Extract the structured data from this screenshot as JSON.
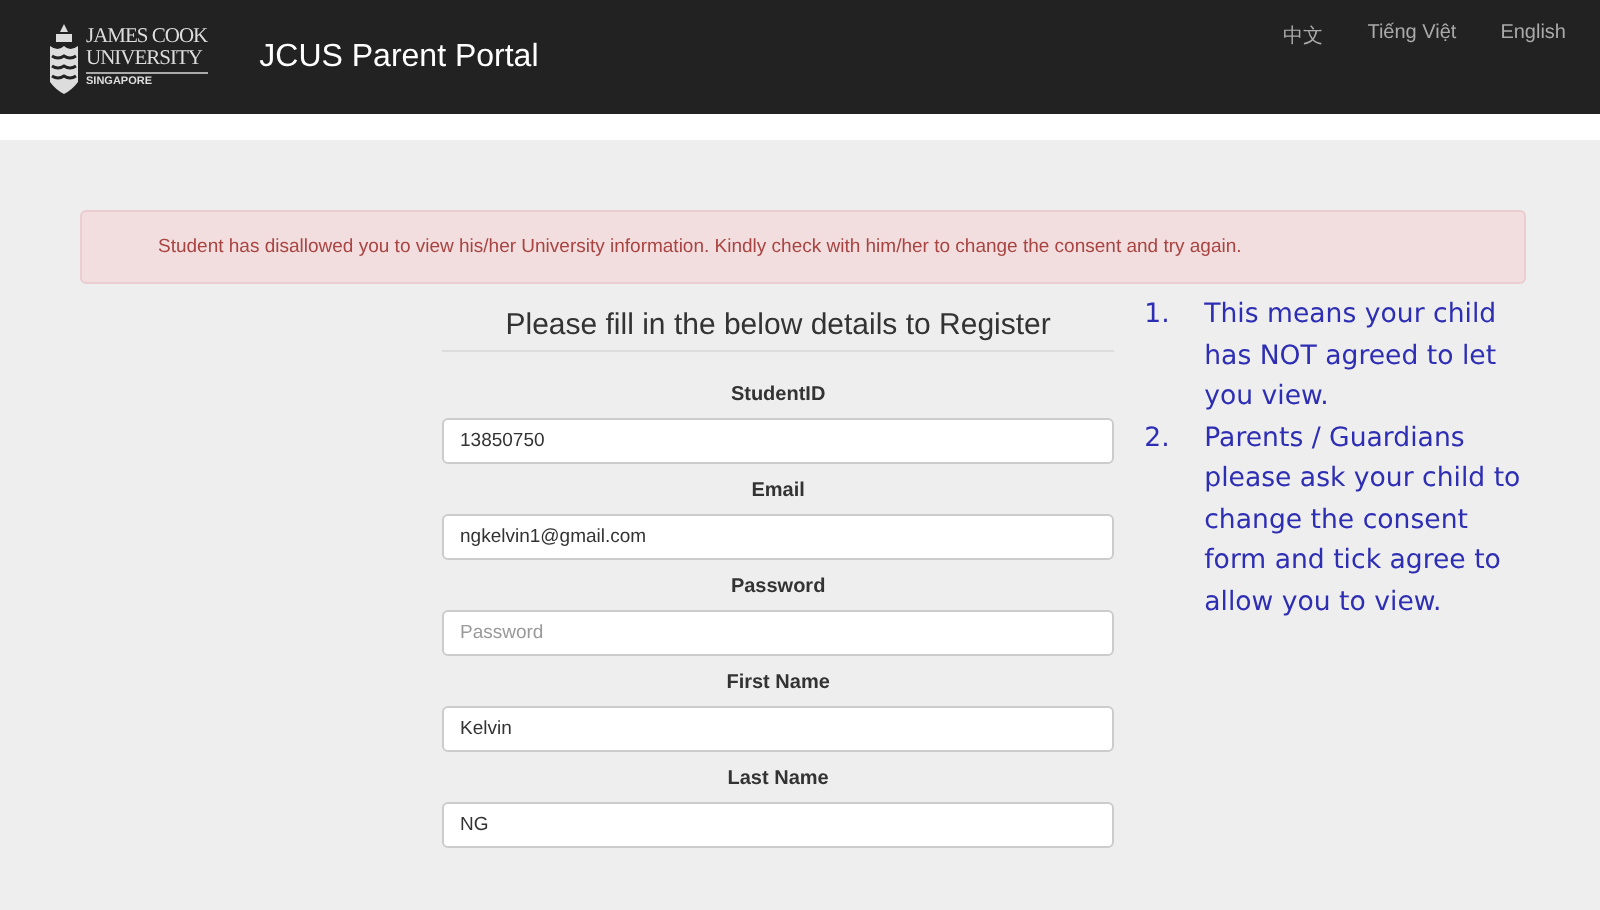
{
  "navbar": {
    "logo": {
      "line_1": "JAMES COOK",
      "line_2": "UNIVERSITY",
      "line_3": "SINGAPORE"
    },
    "title": "JCUS Parent Portal",
    "languages": [
      "中文",
      "Tiếng Việt",
      "English"
    ]
  },
  "alert": {
    "message": "Student has disallowed you to view his/her University information. Kindly check with him/her to change the consent and try again."
  },
  "form": {
    "heading": "Please fill in the below details to Register",
    "fields": [
      {
        "label": "StudentID",
        "value": "13850750"
      },
      {
        "label": "Email",
        "value": "ngkelvin1@gmail.com"
      },
      {
        "label": "Password",
        "placeholder": "Password"
      },
      {
        "label": "First Name",
        "value": "Kelvin"
      },
      {
        "label": "Last Name",
        "value": "NG"
      }
    ]
  },
  "notes": [
    {
      "number": "1.",
      "text": "This means your child has NOT agreed to let you view."
    },
    {
      "number": "2.",
      "text": "Parents / Guardians please ask your child to change the consent form and tick agree to allow you to view."
    }
  ]
}
